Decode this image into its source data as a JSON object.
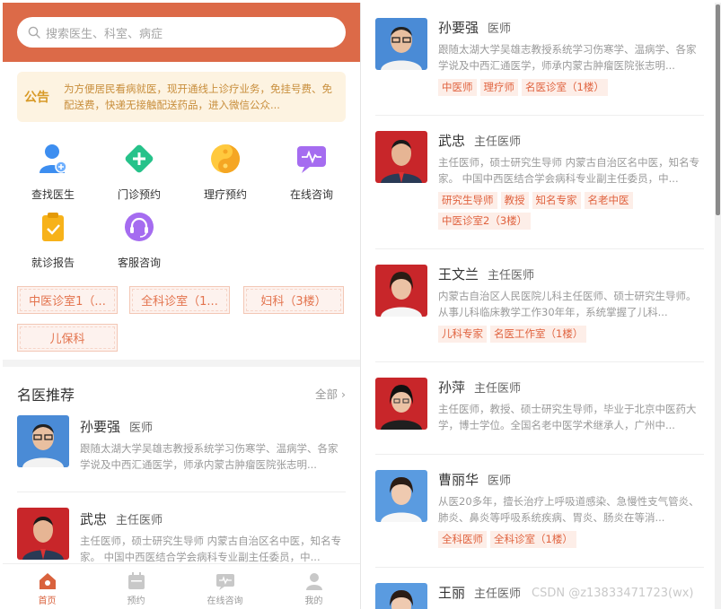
{
  "search": {
    "placeholder": "搜索医生、科室、病症"
  },
  "notice": {
    "tag": "公告",
    "text": "为方便居民看病就医，现开通线上诊疗业务，免挂号费、免配送费，快递无接触配送药品，进入微信公众..."
  },
  "services": [
    {
      "label": "查找医生",
      "icon": "find-doctor-icon"
    },
    {
      "label": "门诊预约",
      "icon": "clinic-appointment-icon"
    },
    {
      "label": "理疗预约",
      "icon": "therapy-appointment-icon"
    },
    {
      "label": "在线咨询",
      "icon": "online-consult-icon"
    },
    {
      "label": "就诊报告",
      "icon": "report-icon"
    },
    {
      "label": "客服咨询",
      "icon": "customer-service-icon"
    }
  ],
  "departments": [
    "中医诊室1（...",
    "全科诊室（1...",
    "妇科（3楼）",
    "儿保科"
  ],
  "recommend": {
    "title": "名医推荐",
    "more": "全部"
  },
  "left_doctors": [
    {
      "name": "孙要强",
      "title": "医师",
      "desc": "跟随太湖大学吴雄志教授系统学习伤寒学、温病学、各家学说及中西汇通医学，师承内蒙古肿瘤医院张志明..."
    },
    {
      "name": "武忠",
      "title": "主任医师",
      "desc": "主任医师，硕士研究生导师 内蒙古自治区名中医，知名专家。 中国中西医结合学会病科专业副主任委员，中..."
    }
  ],
  "tabs": [
    {
      "label": "首页",
      "icon": "home-icon"
    },
    {
      "label": "预约",
      "icon": "calendar-icon"
    },
    {
      "label": "在线咨询",
      "icon": "chat-icon"
    },
    {
      "label": "我的",
      "icon": "user-icon"
    }
  ],
  "right_doctors": [
    {
      "name": "孙要强",
      "title": "医师",
      "desc": "跟随太湖大学吴雄志教授系统学习伤寒学、温病学、各家学说及中西汇通医学，师承内蒙古肿瘤医院张志明...",
      "tags": [
        "中医师",
        "理疗师",
        "名医诊室（1楼）"
      ]
    },
    {
      "name": "武忠",
      "title": "主任医师",
      "desc": "主任医师，硕士研究生导师 内蒙古自治区名中医，知名专家。 中国中西医结合学会病科专业副主任委员，中...",
      "tags": [
        "研究生导师",
        "教授",
        "知名专家",
        "名老中医",
        "中医诊室2（3楼）"
      ]
    },
    {
      "name": "王文兰",
      "title": "主任医师",
      "desc": "内蒙古自治区人民医院儿科主任医师、硕士研究生导师。从事儿科临床教学工作30年年，系统掌握了儿科...",
      "tags": [
        "儿科专家",
        "名医工作室（1楼）"
      ]
    },
    {
      "name": "孙萍",
      "title": "主任医师",
      "desc": "主任医师，教授、硕士研究生导师，毕业于北京中医药大学，博士学位。全国名老中医学术继承人，广州中...",
      "tags": []
    },
    {
      "name": "曹丽华",
      "title": "医师",
      "desc": "从医20多年，擅长治疗上呼吸道感染、急慢性支气管炎、肺炎、鼻炎等呼吸系统疾病、胃炎、肠炎在等消...",
      "tags": [
        "全科医师",
        "全科诊室（1楼）"
      ]
    },
    {
      "name": "王丽",
      "title": "主任医师",
      "desc": "",
      "tags": []
    }
  ],
  "watermark": "CSDN @z13833471723(wx)",
  "colors": {
    "brand": "#dc6a48",
    "tag_text": "#e0633f",
    "tag_bg": "#fdeee8"
  }
}
